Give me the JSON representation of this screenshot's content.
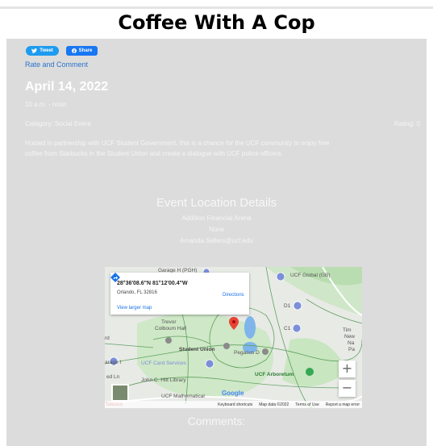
{
  "page": {
    "title": "Coffee With A Cop"
  },
  "social": {
    "tweet_label": "Tweet",
    "share_label": "Share"
  },
  "rate_link": "Rate and Comment",
  "event": {
    "date": "April 14, 2022",
    "time": "10 a.m. - noon",
    "category": "Category: Social Event",
    "rating": "Rating: 0",
    "description": "Hosted in partnership with UCF Student Government, this is a chance for the UCF community to enjoy free coffee from Starbucks in the Student Union and create a dialogue with UCF police officers."
  },
  "location": {
    "heading": "Event Location Details",
    "venue": "Addition Financial Arena",
    "room": "None",
    "contact": "Amanda.Sellers@ucf.edu"
  },
  "map": {
    "coords": "28°36'08.6\"N 81°12'00.4\"W",
    "address": "Orlando, FL 32816",
    "directions_label": "Directions",
    "larger_map_label": "View larger map",
    "zoom_in": "+",
    "zoom_out": "−",
    "google_label": "Google",
    "places": [
      "Garage H (PGH)",
      "UCF Global (GB)",
      "D1",
      "C1",
      "Trevor Colboum Hall",
      "Student Union",
      "UCF Card Services",
      "UCF Arboretum",
      "John C. Hitt Library",
      "Pegasus D",
      "UCF Mathematical Sciences Building",
      "Tim New Na Pa",
      "Parking Garage I",
      "arage I",
      "ed Ln",
      "rd",
      "Telesco"
    ],
    "attribution": [
      "Keyboard shortcuts",
      "Map data ©2022",
      "Terms of Use",
      "Report a map error"
    ],
    "colors": {
      "land": "#e8eae6",
      "park": "#c8e6c0",
      "water": "#7fb5ea",
      "pin": "#ea4335",
      "poi": "#7b8fd9"
    }
  },
  "comments": {
    "heading": "Comments:"
  }
}
